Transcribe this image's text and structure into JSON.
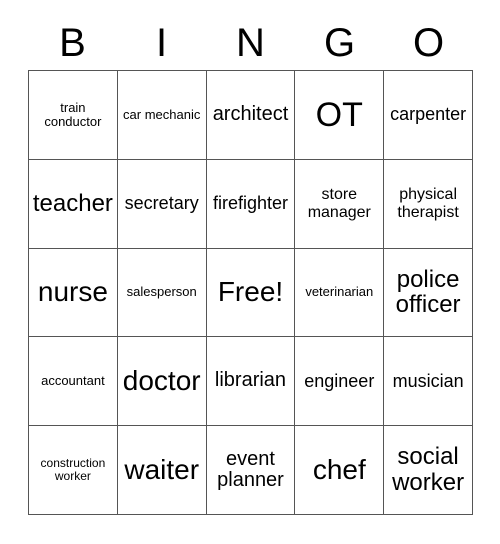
{
  "card": {
    "header_letters": [
      "B",
      "I",
      "N",
      "G",
      "O"
    ],
    "free_space_label": "Free!",
    "rows": [
      [
        {
          "label": "train conductor",
          "size": "xs"
        },
        {
          "label": "car mechanic",
          "size": "xs"
        },
        {
          "label": "architect",
          "size": "l"
        },
        {
          "label": "OT",
          "size": "h"
        },
        {
          "label": "carpenter",
          "size": "m"
        }
      ],
      [
        {
          "label": "teacher",
          "size": "xl"
        },
        {
          "label": "secretary",
          "size": "m"
        },
        {
          "label": "firefighter",
          "size": "m"
        },
        {
          "label": "store manager",
          "size": "s"
        },
        {
          "label": "physical therapist",
          "size": "s"
        }
      ],
      [
        {
          "label": "nurse",
          "size": "xxl"
        },
        {
          "label": "salesperson",
          "size": "xs"
        },
        {
          "label": "Free!",
          "size": "xxl"
        },
        {
          "label": "veterinarian",
          "size": "xs"
        },
        {
          "label": "police officer",
          "size": "xl"
        }
      ],
      [
        {
          "label": "accountant",
          "size": "xs"
        },
        {
          "label": "doctor",
          "size": "xxl"
        },
        {
          "label": "librarian",
          "size": "l"
        },
        {
          "label": "engineer",
          "size": "m"
        },
        {
          "label": "musician",
          "size": "m"
        }
      ],
      [
        {
          "label": "construction worker",
          "size": "xxs"
        },
        {
          "label": "waiter",
          "size": "xxl"
        },
        {
          "label": "event planner",
          "size": "l"
        },
        {
          "label": "chef",
          "size": "xxl"
        },
        {
          "label": "social worker",
          "size": "xl"
        }
      ]
    ],
    "colors": {
      "background": "#ffffff",
      "text": "#000000",
      "grid_line": "#555555"
    }
  }
}
